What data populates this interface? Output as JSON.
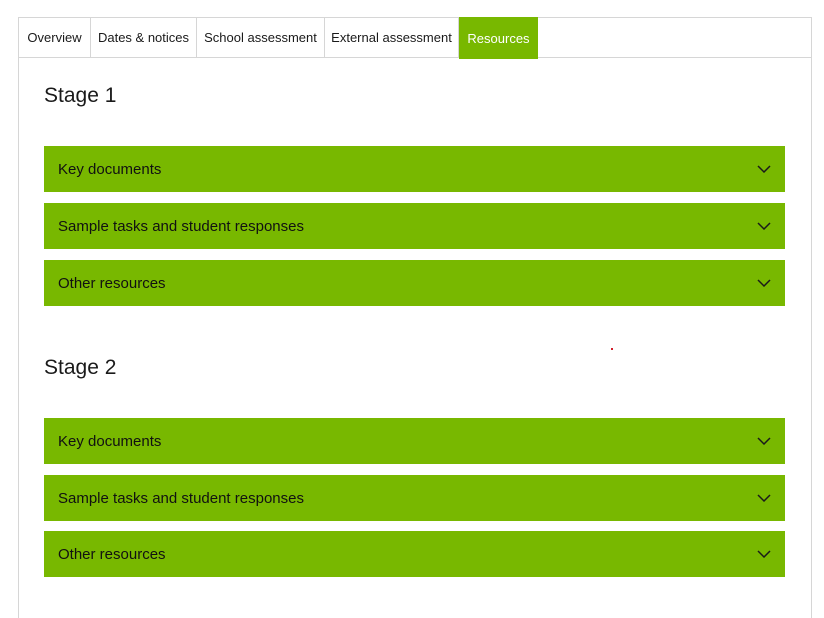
{
  "tabs": [
    {
      "label": "Overview"
    },
    {
      "label": "Dates & notices"
    },
    {
      "label": "School assessment"
    },
    {
      "label": "External assessment"
    },
    {
      "label": "Resources"
    }
  ],
  "active_tab": "Resources",
  "stages": [
    {
      "title": "Stage 1",
      "sections": [
        {
          "label": "Key documents"
        },
        {
          "label": "Sample tasks and student responses"
        },
        {
          "label": "Other resources"
        }
      ]
    },
    {
      "title": "Stage 2",
      "sections": [
        {
          "label": "Key documents"
        },
        {
          "label": "Sample tasks and student responses"
        },
        {
          "label": "Other resources"
        }
      ]
    }
  ],
  "colors": {
    "accent": "#78b800",
    "border": "#d6d6d6"
  },
  "icons": {
    "accordion": "chevron-down-icon"
  }
}
